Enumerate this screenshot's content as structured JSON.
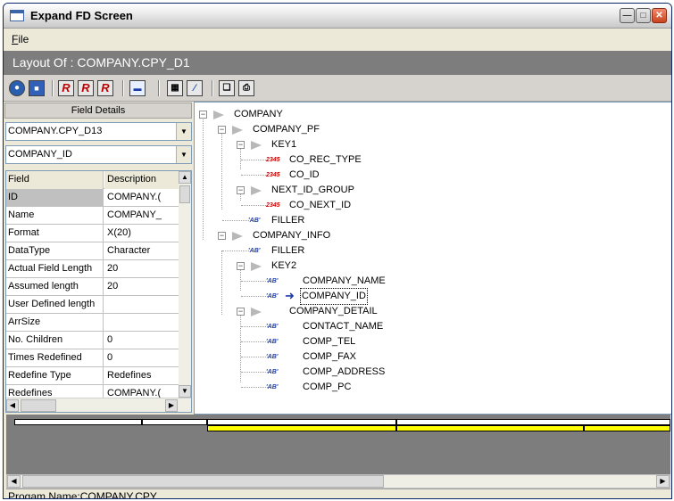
{
  "window": {
    "title": "Expand FD Screen"
  },
  "menu": {
    "file": "File"
  },
  "layout": {
    "title": "Layout Of : COMPANY.CPY_D1"
  },
  "toolbar": {
    "icons": [
      "globe-icon",
      "save-disk-icon",
      "r-icon",
      "r-figure-icon",
      "r-x-icon",
      "screen-icon",
      "floppy-icon",
      "brush-icon",
      "copy-icon",
      "print-icon"
    ]
  },
  "field_details": {
    "header": "Field Details",
    "combo1": "COMPANY.CPY_D13",
    "combo2": "COMPANY_ID",
    "columns": [
      "Field",
      "Description"
    ],
    "rows": [
      {
        "field": "ID",
        "value": "COMPANY.("
      },
      {
        "field": "Name",
        "value": "COMPANY_"
      },
      {
        "field": "Format",
        "value": "X(20)"
      },
      {
        "field": "DataType",
        "value": "Character"
      },
      {
        "field": "Actual Field Length",
        "value": "20"
      },
      {
        "field": "Assumed length",
        "value": "20"
      },
      {
        "field": "User Defined length",
        "value": ""
      },
      {
        "field": "ArrSize",
        "value": ""
      },
      {
        "field": "No. Children",
        "value": "0"
      },
      {
        "field": "Times Redefined",
        "value": "0"
      },
      {
        "field": "Redefine Type",
        "value": "Redefines"
      },
      {
        "field": "Redefines",
        "value": "COMPANY.("
      }
    ]
  },
  "tree": {
    "num_badge": "2345",
    "alpha_badge": "'AB'",
    "nodes": [
      {
        "label": "COMPANY",
        "kind": "group",
        "level": 0
      },
      {
        "label": "COMPANY_PF",
        "kind": "group",
        "level": 1
      },
      {
        "label": "KEY1",
        "kind": "group",
        "level": 2
      },
      {
        "label": "CO_REC_TYPE",
        "kind": "numeric",
        "level": 3
      },
      {
        "label": "CO_ID",
        "kind": "numeric",
        "level": 3
      },
      {
        "label": "NEXT_ID_GROUP",
        "kind": "group",
        "level": 2
      },
      {
        "label": "CO_NEXT_ID",
        "kind": "numeric",
        "level": 3
      },
      {
        "label": "FILLER",
        "kind": "alpha",
        "level": 2
      },
      {
        "label": "COMPANY_INFO",
        "kind": "group",
        "level": 1
      },
      {
        "label": "FILLER",
        "kind": "alpha",
        "level": 2
      },
      {
        "label": "KEY2",
        "kind": "group",
        "level": 2
      },
      {
        "label": "COMPANY_NAME",
        "kind": "alpha",
        "level": 3
      },
      {
        "label": "COMPANY_ID",
        "kind": "alpha",
        "level": 3,
        "selected": true
      },
      {
        "label": "COMPANY_DETAIL",
        "kind": "group",
        "level": 2
      },
      {
        "label": "CONTACT_NAME",
        "kind": "alpha",
        "level": 3
      },
      {
        "label": "COMP_TEL",
        "kind": "alpha",
        "level": 3
      },
      {
        "label": "COMP_FAX",
        "kind": "alpha",
        "level": 3
      },
      {
        "label": "COMP_ADDRESS",
        "kind": "alpha",
        "level": 3
      },
      {
        "label": "COMP_PC",
        "kind": "alpha",
        "level": 3
      }
    ]
  },
  "status": {
    "text": "Progam Name:COMPANY.CPY"
  }
}
